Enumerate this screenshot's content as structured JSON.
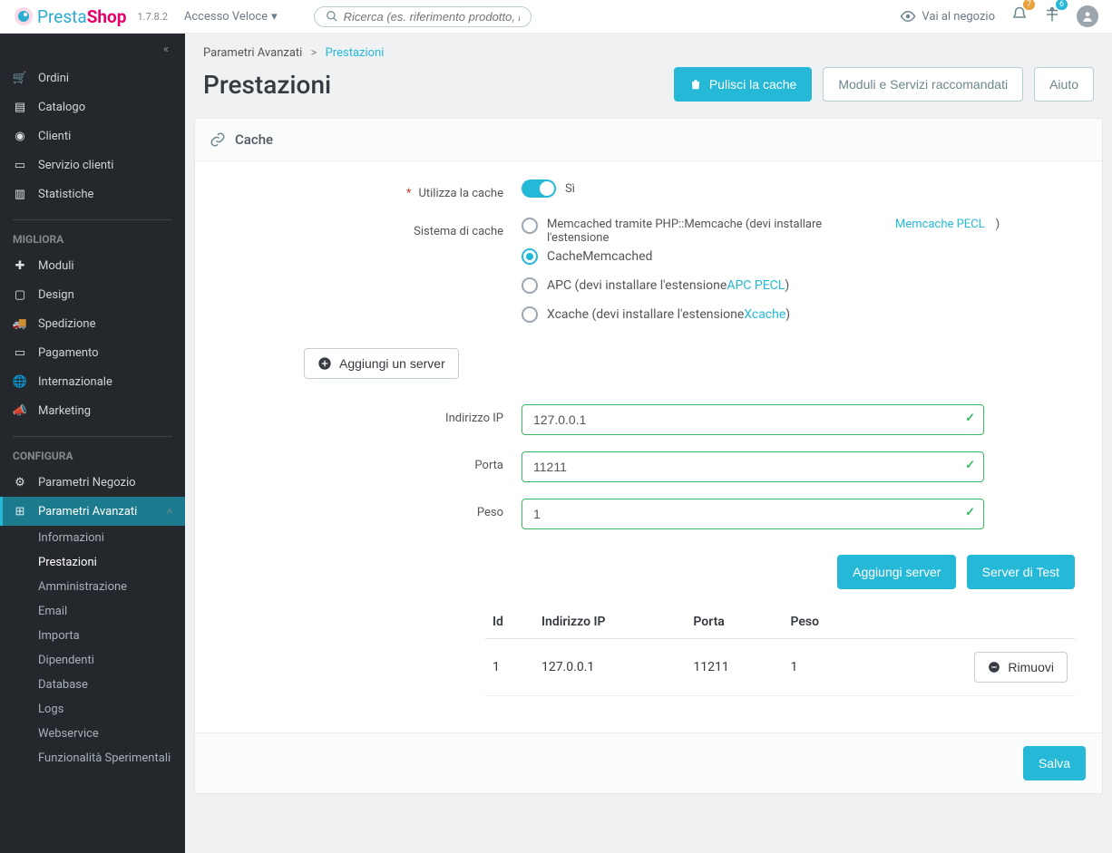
{
  "topbar": {
    "version": "1.7.8.2",
    "quick_access": "Accesso Veloce",
    "search_placeholder": "Ricerca (es. riferimento prodotto, nome)",
    "go_to_shop": "Vai al negozio",
    "notif_count": "7",
    "support_count": "6"
  },
  "sidebar": {
    "vendi": [
      {
        "icon": "cart",
        "label": "Ordini"
      },
      {
        "icon": "tag",
        "label": "Catalogo"
      },
      {
        "icon": "person",
        "label": "Clienti"
      },
      {
        "icon": "chat",
        "label": "Servizio clienti"
      },
      {
        "icon": "stats",
        "label": "Statistiche"
      }
    ],
    "migliora_title": "MIGLIORA",
    "migliora": [
      {
        "icon": "puzzle",
        "label": "Moduli"
      },
      {
        "icon": "monitor",
        "label": "Design"
      },
      {
        "icon": "truck",
        "label": "Spedizione"
      },
      {
        "icon": "card",
        "label": "Pagamento"
      },
      {
        "icon": "globe",
        "label": "Internazionale"
      },
      {
        "icon": "mega",
        "label": "Marketing"
      }
    ],
    "configura_title": "CONFIGURA",
    "configura": [
      {
        "icon": "gear",
        "label": "Parametri Negozio"
      },
      {
        "icon": "sliders",
        "label": "Parametri Avanzati",
        "active": true
      }
    ],
    "sub": [
      "Informazioni",
      "Prestazioni",
      "Amministrazione",
      "Email",
      "Importa",
      "Dipendenti",
      "Database",
      "Logs",
      "Webservice",
      "Funzionalità Sperimentali"
    ]
  },
  "breadcrumb": {
    "parent": "Parametri Avanzati",
    "current": "Prestazioni"
  },
  "header": {
    "title": "Prestazioni",
    "clear_cache": "Pulisci la cache",
    "recommended": "Moduli e Servizi raccomandati",
    "help": "Aiuto"
  },
  "panel": {
    "title": "Cache",
    "use_cache_label": "Utilizza la cache",
    "use_cache_val": "Sì",
    "sys_label": "Sistema di cache",
    "opt1_text": "Memcached tramite PHP::Memcache (devi installare l'estensione",
    "opt1_link": "Memcache PECL",
    "opt2_text": "CacheMemcached",
    "opt3_text": "APC (devi installare l'estensione",
    "opt3_link": "APC PECL",
    "opt4_text": "Xcache (devi installare l'estensione",
    "opt4_link": "Xcache",
    "add_server_btn": "Aggiungi un server",
    "ip_label": "Indirizzo IP",
    "port_label": "Porta",
    "weight_label": "Peso",
    "ip_val": "127.0.0.1",
    "port_val": "11211",
    "weight_val": "1",
    "add_server": "Aggiungi server",
    "test_server": "Server di Test",
    "th_id": "Id",
    "th_ip": "Indirizzo IP",
    "th_port": "Porta",
    "th_weight": "Peso",
    "row": {
      "id": "1",
      "ip": "127.0.0.1",
      "port": "11211",
      "weight": "1"
    },
    "remove": "Rimuovi",
    "save": "Salva"
  }
}
